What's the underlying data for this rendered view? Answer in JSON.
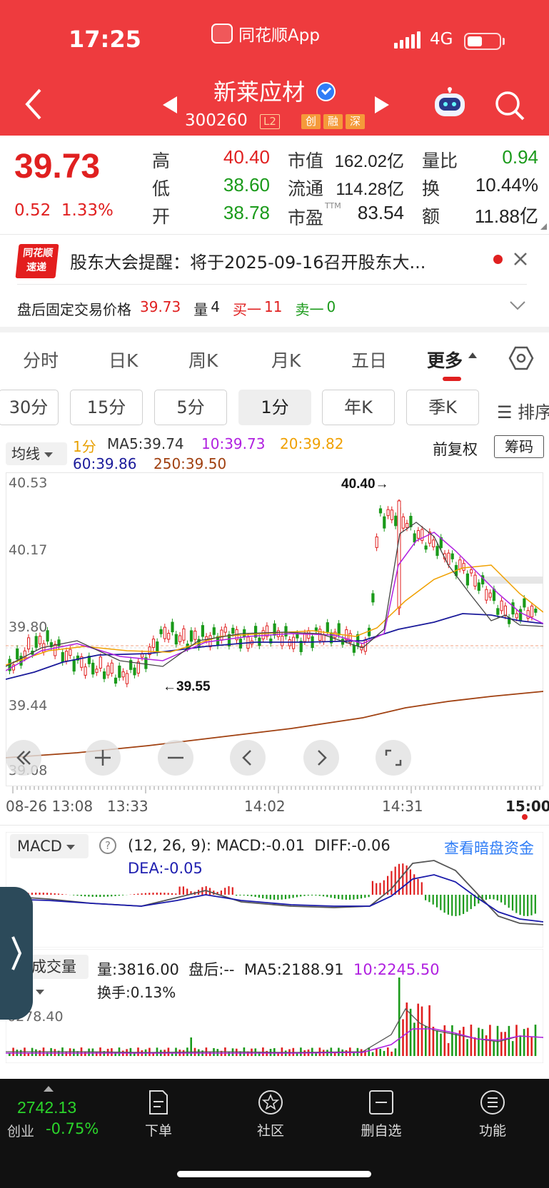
{
  "status_bar": {
    "time": "17:25",
    "app": "同花顺App",
    "network": "4G"
  },
  "header": {
    "stock_name": "新莱应材",
    "stock_code": "300260",
    "level_tag": "L2",
    "tags": [
      "创",
      "融",
      "深"
    ]
  },
  "quote": {
    "price": "39.73",
    "change": "0.52",
    "change_pct": "1.33%",
    "stats": [
      {
        "label": "高",
        "value": "40.40"
      },
      {
        "label": "低",
        "value": "38.60"
      },
      {
        "label": "开",
        "value": "38.78"
      },
      {
        "label": "市值",
        "value": "162.02亿"
      },
      {
        "label": "流通",
        "value": "114.28亿"
      },
      {
        "label": "市盈",
        "sup": "TTM",
        "value": "83.54"
      },
      {
        "label": "量比",
        "value": "0.94"
      },
      {
        "label": "换",
        "value": "10.44%"
      },
      {
        "label": "额",
        "value": "11.88亿"
      }
    ]
  },
  "notice": {
    "logo_line1": "同花顺",
    "logo_line2": "速递",
    "text": "股东大会提醒：将于2025-09-16召开股东大..."
  },
  "after_hours": {
    "label": "盘后固定交易价格",
    "price": "39.73",
    "volume_label": "量",
    "volume": "4",
    "buy_label": "买一",
    "buy": "11",
    "sell_label": "卖一",
    "sell": "0"
  },
  "chart_tabs": [
    "分时",
    "日K",
    "周K",
    "月K",
    "五日",
    "更多"
  ],
  "periods": [
    "30分",
    "15分",
    "5分",
    "1分",
    "年K",
    "季K"
  ],
  "sort_label": "☰ 排序",
  "indicator": {
    "main_select": "均线",
    "period": "1分",
    "ma5": "MA5:39.74",
    "ma10": "10:39.73",
    "ma20": "20:39.82",
    "ma60": "60:39.86",
    "ma250": "250:39.50",
    "adjust": "前复权",
    "chip": "筹码"
  },
  "chart_data": {
    "type": "candlestick",
    "y_ticks": [
      "40.53",
      "40.17",
      "39.80",
      "39.44",
      "39.08"
    ],
    "x_ticks": [
      "08-26 13:08",
      "13:33",
      "14:02",
      "14:31",
      "15:00"
    ],
    "ylim": [
      39.08,
      40.53
    ],
    "high_marker": "40.40→",
    "low_marker": "←39.55"
  },
  "macd": {
    "select": "MACD",
    "params": "(12, 26, 9):",
    "macd": "MACD:-0.01",
    "diff": "DIFF:-0.06",
    "dea": "DEA:-0.05",
    "link": "查看暗盘资金"
  },
  "volume": {
    "select": "成交量",
    "vol": "量:3816.00",
    "after": "盘后:--",
    "ma5": "MA5:2188.91",
    "ma10": "10:2245.50",
    "turnover": "换手:0.13%",
    "scale": "6278.40"
  },
  "bottom": {
    "index_value": "2742.13",
    "index_name": "创业",
    "index_change": "-0.75%",
    "nav": [
      "下单",
      "社区",
      "删自选",
      "功能"
    ]
  },
  "colors": {
    "brand_red": "#ee3b3e",
    "up": "#e02020",
    "down": "#1a9a1a"
  }
}
